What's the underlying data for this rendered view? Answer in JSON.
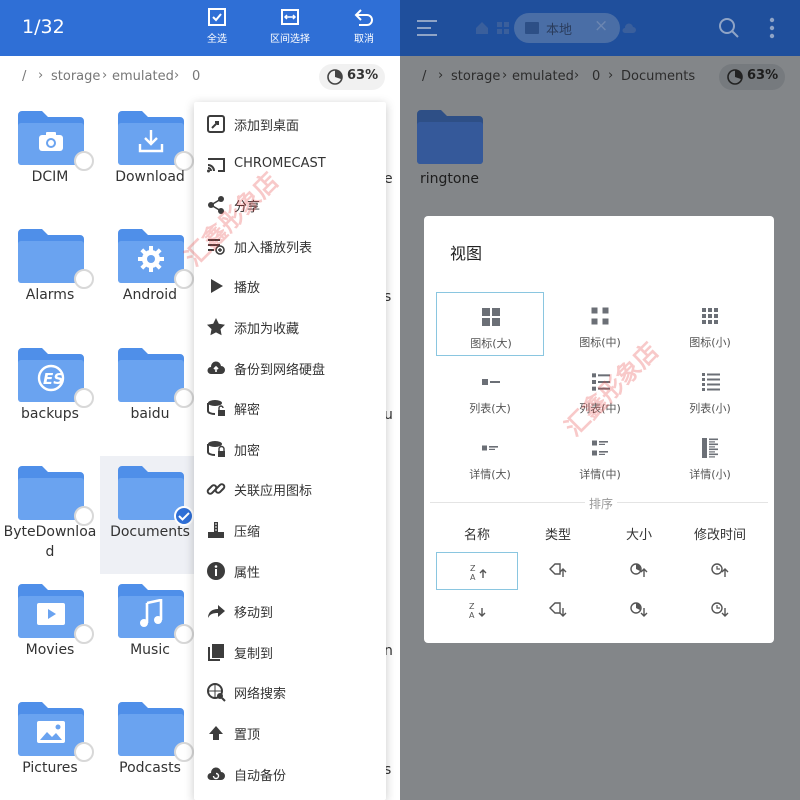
{
  "left": {
    "selection_count": "1/32",
    "toolbar": [
      {
        "label": "全选",
        "icon": "select-all-icon"
      },
      {
        "label": "区间选择",
        "icon": "range-select-icon"
      },
      {
        "label": "取消",
        "icon": "cancel-icon"
      }
    ],
    "breadcrumb": [
      "/",
      "storage",
      "emulated",
      "0"
    ],
    "storage_usage": "63%",
    "folders": [
      {
        "name": "DCIM",
        "glyph": "camera-icon"
      },
      {
        "name": "Download",
        "glyph": "download-icon"
      },
      {
        "name": "Alarms",
        "glyph": ""
      },
      {
        "name": "Android",
        "glyph": "gear-icon"
      },
      {
        "name": "backups",
        "glyph": "es-logo-icon"
      },
      {
        "name": "baidu",
        "glyph": ""
      },
      {
        "name": "ByteDownload",
        "glyph": ""
      },
      {
        "name": "Documents",
        "glyph": "",
        "selected": true
      },
      {
        "name": "Movies",
        "glyph": "play-icon"
      },
      {
        "name": "Music",
        "glyph": "music-note-icon"
      },
      {
        "name": "Pictures",
        "glyph": "image-icon"
      },
      {
        "name": "Podcasts",
        "glyph": ""
      }
    ],
    "clipped_letters": [
      "e",
      "s",
      "u",
      "n",
      "s"
    ],
    "context_menu": [
      {
        "label": "添加到桌面",
        "icon": "add-to-desktop-icon"
      },
      {
        "label": "CHROMECAST",
        "icon": "cast-icon"
      },
      {
        "label": "分享",
        "icon": "share-icon"
      },
      {
        "label": "加入播放列表",
        "icon": "playlist-add-icon"
      },
      {
        "label": "播放",
        "icon": "play-icon"
      },
      {
        "label": "添加为收藏",
        "icon": "star-icon"
      },
      {
        "label": "备份到网络硬盘",
        "icon": "cloud-upload-icon"
      },
      {
        "label": "解密",
        "icon": "decrypt-icon"
      },
      {
        "label": "加密",
        "icon": "encrypt-icon"
      },
      {
        "label": "关联应用图标",
        "icon": "link-icon"
      },
      {
        "label": "压缩",
        "icon": "compress-icon"
      },
      {
        "label": "属性",
        "icon": "info-icon"
      },
      {
        "label": "移动到",
        "icon": "move-icon"
      },
      {
        "label": "复制到",
        "icon": "copy-icon"
      },
      {
        "label": "网络搜索",
        "icon": "web-search-icon"
      },
      {
        "label": "置顶",
        "icon": "pin-top-icon"
      },
      {
        "label": "自动备份",
        "icon": "auto-backup-icon"
      }
    ],
    "watermark": "汇鑫彤象店"
  },
  "right": {
    "tab_label": "本地",
    "breadcrumb": [
      "/",
      "storage",
      "emulated",
      "0",
      "Documents"
    ],
    "storage_usage": "63%",
    "folder_name": "ringtone",
    "dialog": {
      "title": "视图",
      "view_options": [
        {
          "label": "图标(大)",
          "icon": "grid-large-icon",
          "active": true
        },
        {
          "label": "图标(中)",
          "icon": "grid-medium-icon"
        },
        {
          "label": "图标(小)",
          "icon": "grid-small-icon"
        },
        {
          "label": "列表(大)",
          "icon": "list-large-icon"
        },
        {
          "label": "列表(中)",
          "icon": "list-medium-icon"
        },
        {
          "label": "列表(小)",
          "icon": "list-small-icon"
        },
        {
          "label": "详情(大)",
          "icon": "details-large-icon"
        },
        {
          "label": "详情(中)",
          "icon": "details-medium-icon"
        },
        {
          "label": "详情(小)",
          "icon": "details-small-icon"
        }
      ],
      "sort_title": "排序",
      "sort_columns": [
        "名称",
        "类型",
        "大小",
        "修改时间"
      ],
      "sort_buttons": [
        {
          "icon": "sort-name-asc-icon",
          "active": true
        },
        {
          "icon": "sort-type-asc-icon"
        },
        {
          "icon": "sort-size-asc-icon"
        },
        {
          "icon": "sort-time-asc-icon"
        },
        {
          "icon": "sort-name-desc-icon"
        },
        {
          "icon": "sort-type-desc-icon"
        },
        {
          "icon": "sort-size-desc-icon"
        },
        {
          "icon": "sort-time-desc-icon"
        }
      ]
    },
    "watermark": "汇鑫彤象店"
  },
  "colors": {
    "accent": "#2f6fd6",
    "folder": "#6aa3f0",
    "folder_tab": "#4f8fe9",
    "dim_overlay": "#838689"
  }
}
